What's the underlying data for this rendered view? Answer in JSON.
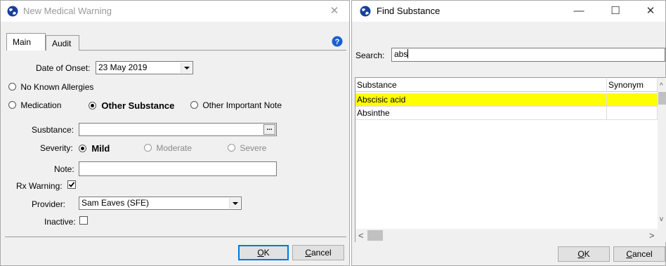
{
  "left_window": {
    "title": "New Medical Warning",
    "close_glyph": "✕",
    "tabs": [
      "Main",
      "Audit"
    ],
    "help_icon": "help-icon",
    "date_of_onset": {
      "label": "Date of Onset:",
      "value": "23 May 2019"
    },
    "no_known_allergies": "No Known Allergies",
    "type_options": [
      "Medication",
      "Other Substance",
      "Other Important Note"
    ],
    "substance": {
      "label": "Susbtance:",
      "value": "",
      "button": "..."
    },
    "severity": {
      "label": "Severity:",
      "options": [
        "Mild",
        "Moderate",
        "Severe"
      ]
    },
    "note": {
      "label": "Note:",
      "value": ""
    },
    "rx_warning": {
      "label": "Rx Warning:"
    },
    "provider": {
      "label": "Provider:",
      "value": "Sam Eaves (SFE)"
    },
    "inactive": {
      "label": "Inactive:"
    },
    "buttons": {
      "ok_key": "O",
      "ok_rest": "K",
      "cancel_key": "C",
      "cancel_rest": "ancel"
    }
  },
  "right_window": {
    "title": "Find Substance",
    "controls": {
      "minimize": "—",
      "maximize": "☐",
      "close": "✕"
    },
    "search": {
      "label": "Search:",
      "value": "abs"
    },
    "columns": [
      "Substance",
      "Synonym"
    ],
    "rows": [
      {
        "substance": "Abscisic acid",
        "synonym": "",
        "highlight": "#ffff00"
      },
      {
        "substance": "Absinthe",
        "synonym": ""
      }
    ],
    "scroll": {
      "left": "<",
      "right": ">",
      "up": "^",
      "down": "v"
    },
    "buttons": {
      "ok_key": "O",
      "ok_rest": "K",
      "cancel_key": "C",
      "cancel_rest": "ancel"
    }
  }
}
